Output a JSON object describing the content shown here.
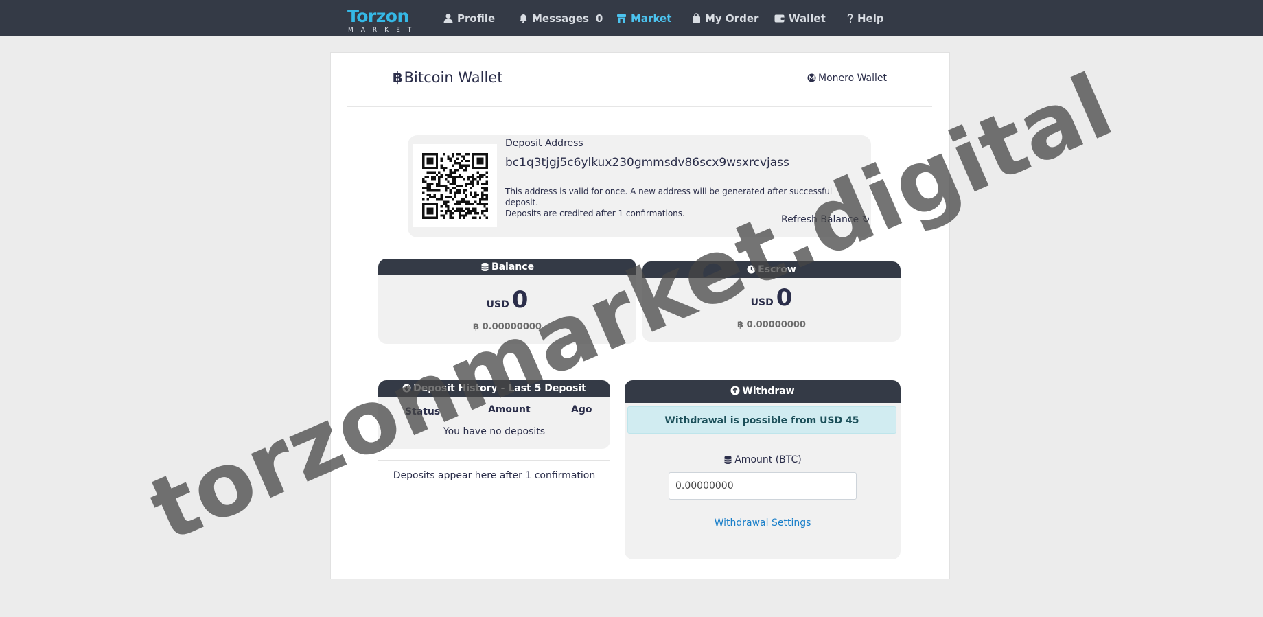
{
  "nav": {
    "logo_word": "Torzon",
    "logo_sub": "MARKET",
    "items": [
      {
        "label": "Profile",
        "icon": "user-icon"
      },
      {
        "label": "Messages",
        "icon": "bell-icon",
        "count": "0"
      },
      {
        "label": "Market",
        "icon": "store-icon",
        "active": true
      },
      {
        "label": "My Order",
        "icon": "bag-icon"
      },
      {
        "label": "Wallet",
        "icon": "wallet-icon"
      },
      {
        "label": "Help",
        "icon": "question-icon"
      }
    ]
  },
  "wallet": {
    "title_symbol": "฿",
    "title": "Bitcoin Wallet",
    "monero_link": "Monero Wallet"
  },
  "deposit": {
    "label": "Deposit Address",
    "address": "bc1q3tjgj5c6ylkux230gmmsdv86scx9wsxrcvjass",
    "note_line1": "This address is valid for once. A new address will be generated after successful deposit.",
    "note_line2": "Deposits are credited after 1 confirmations.",
    "refresh": "Refresh Balance ↻"
  },
  "balance": {
    "title": "Balance",
    "currency": "USD",
    "usd": "0",
    "btc": "฿ 0.00000000"
  },
  "escrow": {
    "title": "Escrow",
    "currency": "USD",
    "usd": "0",
    "btc": "฿ 0.00000000"
  },
  "history": {
    "title": "Deposit History - Last 5 Deposit",
    "columns": [
      "Status",
      "Amount",
      "Ago"
    ],
    "empty": "You have no deposits",
    "footer": "Deposits appear here after 1 confirmation"
  },
  "withdraw": {
    "title": "Withdraw",
    "notice": "Withdrawal is possible from USD 45",
    "amount_label": "Amount (BTC)",
    "amount_value": "0.00000000",
    "settings_link": "Withdrawal Settings"
  },
  "watermark": "torzonmarket.digital",
  "colors": {
    "navbar": "#343a46",
    "accent": "#4cc3ef",
    "link": "#1a7fc9",
    "alert_bg": "#d1ecf1"
  }
}
